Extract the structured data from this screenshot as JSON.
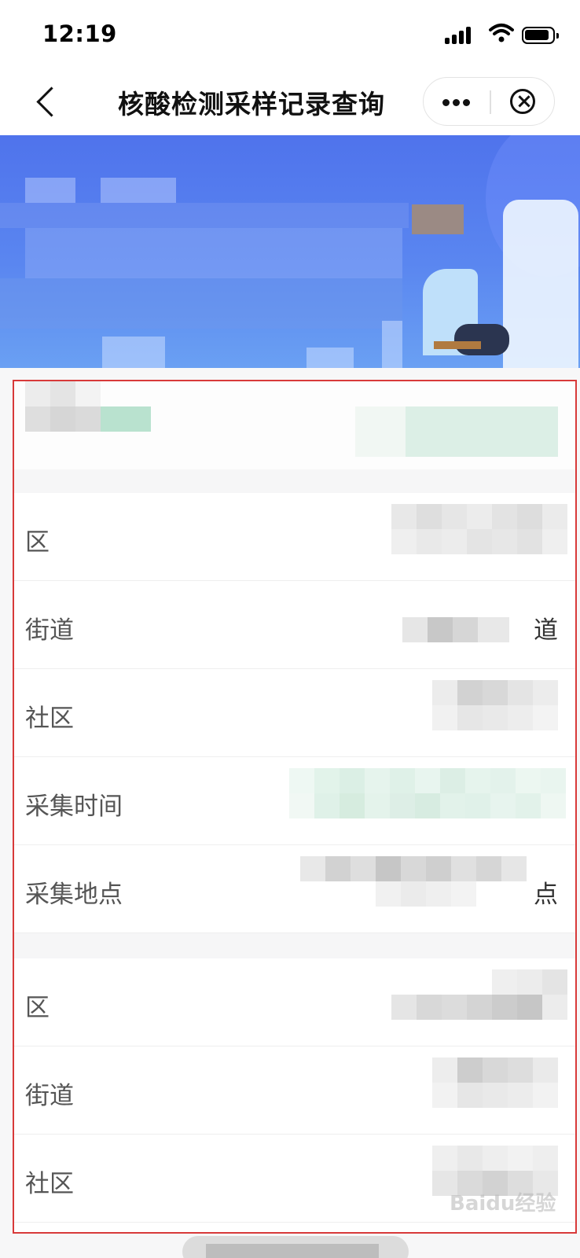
{
  "status_bar": {
    "time": "12:19"
  },
  "nav": {
    "title": "核酸检测采样记录查询"
  },
  "capsule": {
    "close_glyph": "×"
  },
  "section1": {
    "rows": [
      {
        "label": "区",
        "value": ""
      },
      {
        "label": "街道",
        "value": "道"
      },
      {
        "label": "社区",
        "value": ""
      },
      {
        "label": "采集时间",
        "value": ""
      },
      {
        "label": "采集地点",
        "value": "点"
      }
    ]
  },
  "section2": {
    "rows": [
      {
        "label": "区",
        "value": ""
      },
      {
        "label": "街道",
        "value": ""
      },
      {
        "label": "社区",
        "value": ""
      }
    ]
  },
  "watermark": {
    "text": "Baidu经验"
  },
  "colors": {
    "accent_blue": "#4f73ec",
    "border_red": "#d83a3a",
    "blur_green": "#b9e2cf"
  },
  "icons": [
    "signal-icon",
    "wifi-icon",
    "battery-icon",
    "back-icon",
    "more-icon",
    "close-icon"
  ]
}
